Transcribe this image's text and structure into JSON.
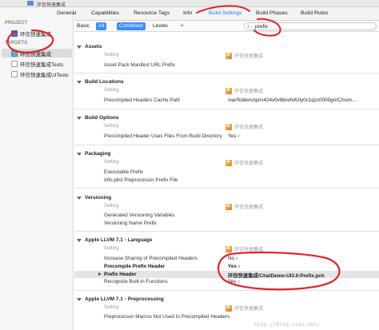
{
  "window": {
    "breadcrumb": "环信快速集成"
  },
  "navigator": {
    "project_header": "PROJECT",
    "project_item": "环信快速集成",
    "targets_header": "TARGETS",
    "targets": [
      "环信快速集成",
      "环信快速集成Tests",
      "环信快速集成UITests"
    ]
  },
  "tabs": [
    "General",
    "Capabilities",
    "Resource Tags",
    "Info",
    "Build Settings",
    "Build Phases",
    "Build Rules"
  ],
  "active_tab": "Build Settings",
  "filter": {
    "basic": "Basic",
    "all": "All",
    "combined": "Combined",
    "levels": "Levels",
    "add": "+",
    "search_value": "prefix"
  },
  "sections": {
    "assets": {
      "title": "Assets",
      "col_setting": "Setting",
      "col_target": "环信快速集成",
      "rows": [
        {
          "setting": "Asset Pack Manifest URL Prefix",
          "value": ""
        }
      ]
    },
    "build_locations": {
      "title": "Build Locations",
      "col_setting": "Setting",
      "col_target": "环信快速集成",
      "rows": [
        {
          "setting": "Precompiled Headers Cache Path",
          "value": "/var/folders/qx/v424v0v96xvfv6zly0c1qcc0000gn/C/com...."
        }
      ]
    },
    "build_options": {
      "title": "Build Options",
      "col_setting": "Setting",
      "col_target": "环信快速集成",
      "rows": [
        {
          "setting": "Precompiled Header Uses Files From Build Directory",
          "value": "Yes"
        }
      ]
    },
    "packaging": {
      "title": "Packaging",
      "col_setting": "Setting",
      "col_target": "环信快速集成",
      "rows": [
        {
          "setting": "Executable Prefix",
          "value": ""
        },
        {
          "setting": "Info.plist Preprocessor Prefix File",
          "value": ""
        }
      ]
    },
    "versioning": {
      "title": "Versioning",
      "col_setting": "Setting",
      "col_target": "环信快速集成",
      "rows": [
        {
          "setting": "Generated Versioning Variables",
          "value": ""
        },
        {
          "setting": "Versioning Name Prefix",
          "value": ""
        }
      ]
    },
    "llvm_language": {
      "title": "Apple LLVM 7.1 - Language",
      "col_setting": "Setting",
      "col_target": "环信快速集成",
      "rows": [
        {
          "setting": "Increase Sharing of Precompiled Headers",
          "value": "No"
        },
        {
          "setting": "Precompile Prefix Header",
          "value": "Yes"
        },
        {
          "setting": "Prefix Header",
          "value": "环信快速集成/ChatDemo-UI3.0-Prefix.pch"
        },
        {
          "setting": "Recognize Built-in Functions",
          "value": "Yes"
        }
      ]
    },
    "llvm_preprocessing": {
      "title": "Apple LLVM 7.1 - Preprocessing",
      "col_setting": "Setting",
      "col_target": "环信快速集成",
      "rows": [
        {
          "setting": "Preprocessor Macros Not Used In Precompiled Headers",
          "value": ""
        }
      ]
    }
  },
  "watermark": "http://blog.csdn.net/",
  "colors": {
    "accent": "#2a78ff",
    "annotation": "#e0242b",
    "selected_row": "#e4e4e4"
  },
  "icons": [
    "search-icon",
    "disclosure-triangle-icon",
    "app-target-icon",
    "project-icon"
  ]
}
